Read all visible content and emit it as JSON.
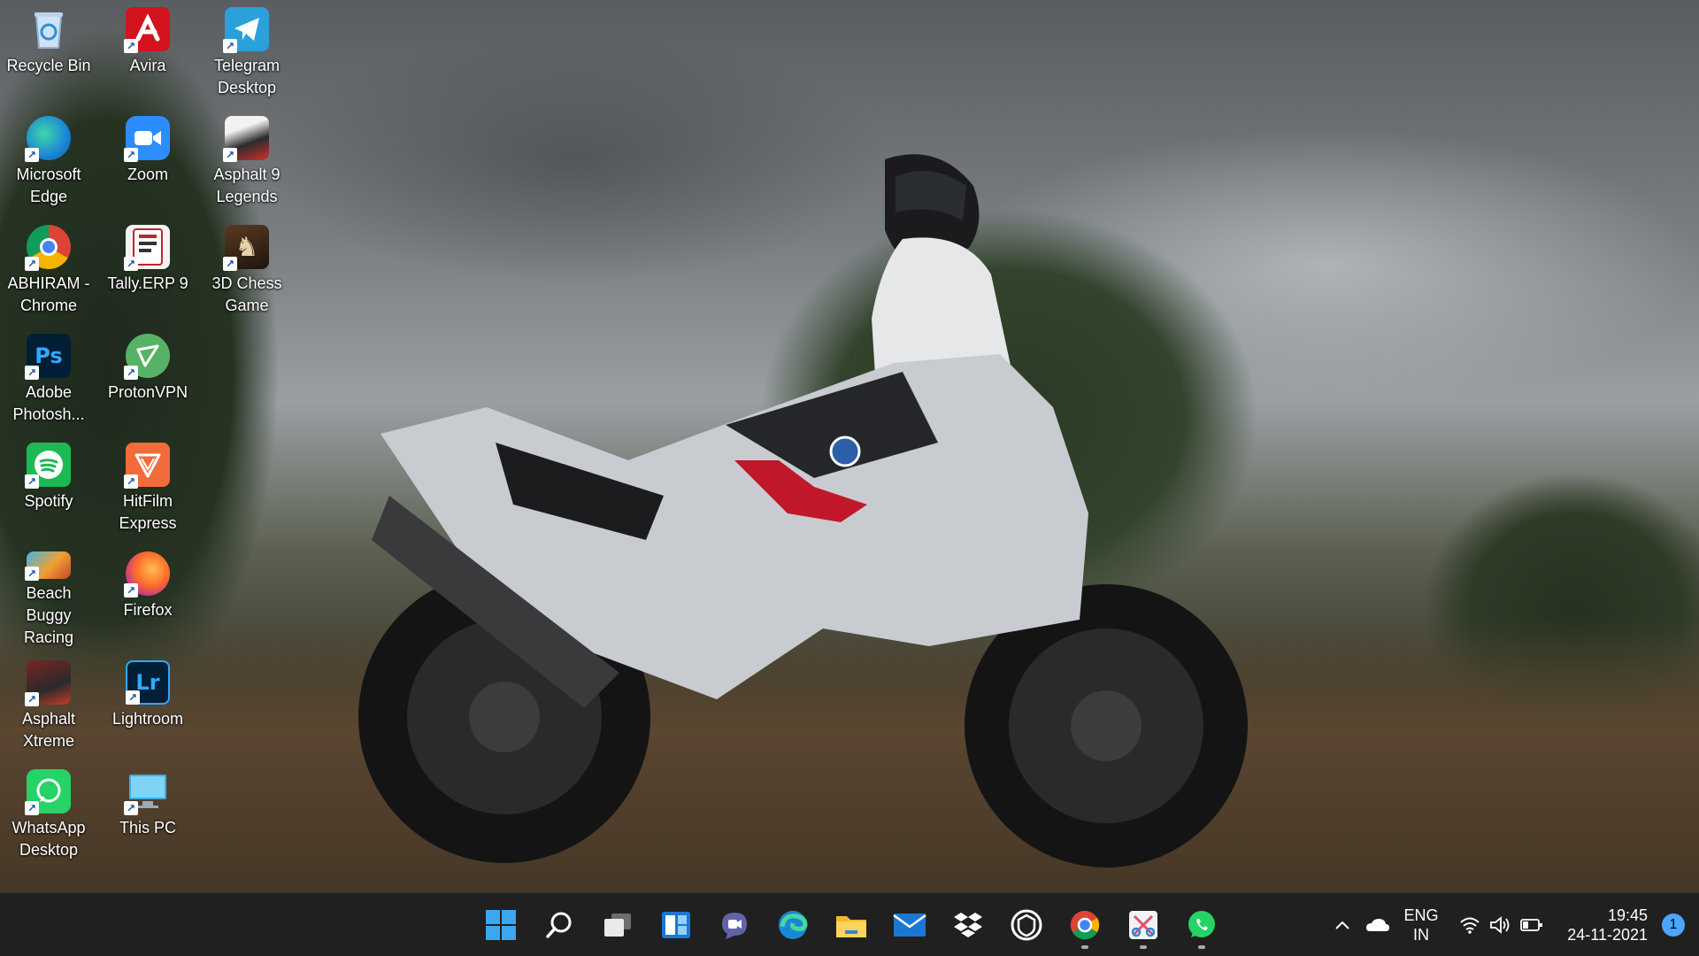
{
  "desktop": {
    "icons": [
      {
        "label": "Recycle Bin",
        "icon": "recycle-bin-icon"
      },
      {
        "label": "Avira",
        "icon": "avira-icon"
      },
      {
        "label": "Telegram Desktop",
        "icon": "telegram-icon"
      },
      {
        "label": "Microsoft Edge",
        "icon": "edge-icon"
      },
      {
        "label": "Zoom",
        "icon": "zoom-icon"
      },
      {
        "label": "Asphalt 9 Legends",
        "icon": "asphalt9-icon"
      },
      {
        "label": "ABHIRAM - Chrome",
        "icon": "chrome-icon"
      },
      {
        "label": "Tally.ERP 9",
        "icon": "tally-icon"
      },
      {
        "label": "3D Chess Game",
        "icon": "chess-icon"
      },
      {
        "label": "Adobe Photosh...",
        "icon": "photoshop-icon",
        "glyph": "Ps"
      },
      {
        "label": "ProtonVPN",
        "icon": "protonvpn-icon"
      },
      {
        "label": "Spotify",
        "icon": "spotify-icon"
      },
      {
        "label": "HitFilm Express",
        "icon": "hitfilm-icon"
      },
      {
        "label": "Beach Buggy Racing",
        "icon": "beach-buggy-icon"
      },
      {
        "label": "Firefox",
        "icon": "firefox-icon"
      },
      {
        "label": "Asphalt Xtreme",
        "icon": "asphalt-xtreme-icon"
      },
      {
        "label": "Lightroom",
        "icon": "lightroom-icon",
        "glyph": "Lr"
      },
      {
        "label": "WhatsApp Desktop",
        "icon": "whatsapp-icon"
      },
      {
        "label": "This PC",
        "icon": "this-pc-icon"
      }
    ]
  },
  "taskbar": {
    "apps": [
      {
        "name": "start",
        "icon": "windows-start-icon",
        "running": false
      },
      {
        "name": "search",
        "icon": "search-icon",
        "running": false
      },
      {
        "name": "task-view",
        "icon": "task-view-icon",
        "running": false
      },
      {
        "name": "widgets",
        "icon": "widgets-icon",
        "running": false
      },
      {
        "name": "chat",
        "icon": "teams-chat-icon",
        "running": false
      },
      {
        "name": "edge",
        "icon": "edge-icon",
        "running": false
      },
      {
        "name": "file-explorer",
        "icon": "folder-icon",
        "running": false
      },
      {
        "name": "mail",
        "icon": "mail-icon",
        "running": false
      },
      {
        "name": "dropbox",
        "icon": "dropbox-icon",
        "running": false
      },
      {
        "name": "shield",
        "icon": "shield-app-icon",
        "running": false
      },
      {
        "name": "chrome",
        "icon": "chrome-icon",
        "running": true
      },
      {
        "name": "snip",
        "icon": "snipping-tool-icon",
        "running": true
      },
      {
        "name": "whatsapp",
        "icon": "whatsapp-icon",
        "running": true
      }
    ],
    "tray": {
      "language_line1": "ENG",
      "language_line2": "IN",
      "time": "19:45",
      "date": "24-11-2021",
      "notification_count": "1"
    }
  },
  "colors": {
    "taskbar_bg": "#202020",
    "accent": "#4ca6ff"
  }
}
